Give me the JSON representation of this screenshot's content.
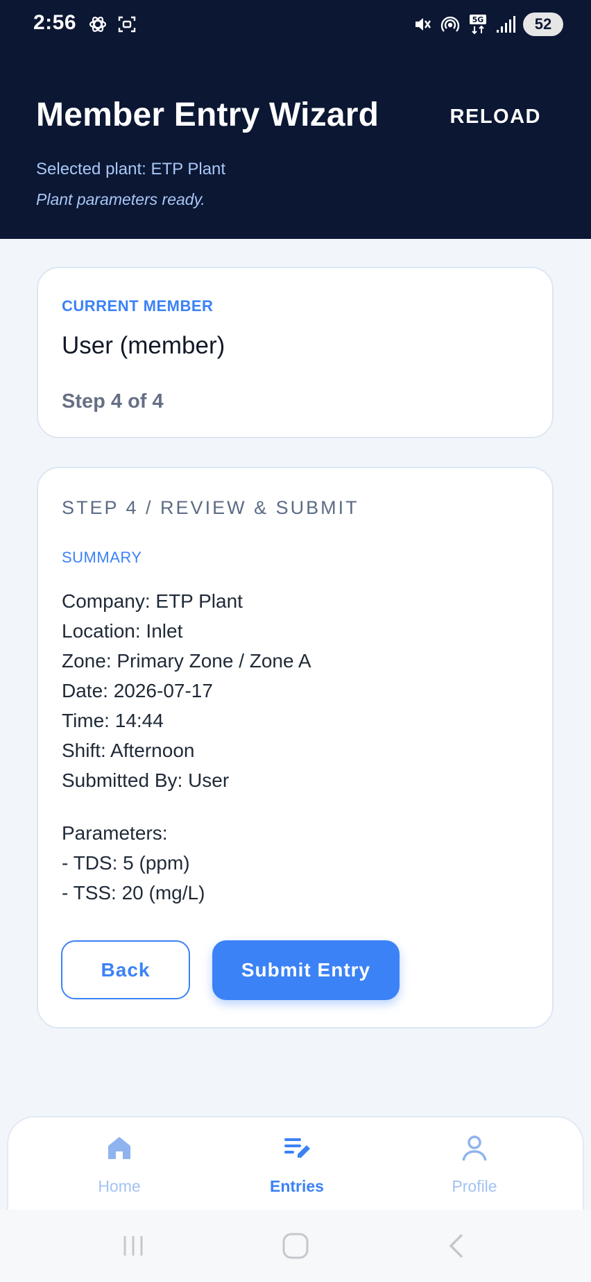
{
  "status_bar": {
    "time": "2:56",
    "battery": "52"
  },
  "header": {
    "title": "Member Entry Wizard",
    "reload_label": "RELOAD",
    "selected_plant": "Selected plant: ETP Plant",
    "status_message": "Plant parameters ready."
  },
  "member_card": {
    "label": "CURRENT MEMBER",
    "name": "User (member)",
    "step": "Step 4 of 4"
  },
  "review_card": {
    "step_title": "STEP 4 / REVIEW & SUBMIT",
    "summary_label": "SUMMARY",
    "summary_lines": [
      "Company: ETP Plant",
      "Location: Inlet",
      "Zone: Primary Zone / Zone A",
      "Date: 2026-07-17",
      "Time: 14:44",
      "Shift: Afternoon",
      "Submitted By: User"
    ],
    "parameters_heading": "Parameters:",
    "parameters": [
      "- TDS: 5 (ppm)",
      "- TSS: 20 (mg/L)"
    ],
    "back_label": "Back",
    "submit_label": "Submit Entry"
  },
  "bottom_nav": {
    "items": [
      {
        "label": "Home",
        "icon": "home-icon",
        "active": false
      },
      {
        "label": "Entries",
        "icon": "edit-list-icon",
        "active": true
      },
      {
        "label": "Profile",
        "icon": "person-icon",
        "active": false
      }
    ]
  },
  "colors": {
    "header_bg": "#0b1733",
    "accent": "#3b82f6",
    "page_bg": "#f2f6fb",
    "subtext": "#a9c7f7"
  }
}
